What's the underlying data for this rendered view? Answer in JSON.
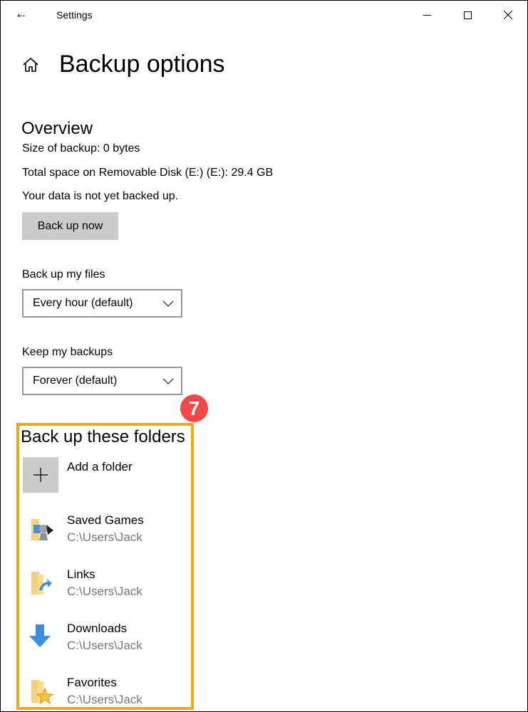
{
  "window": {
    "title": "Settings"
  },
  "page": {
    "title": "Backup options"
  },
  "overview": {
    "heading": "Overview",
    "size": "Size of backup: 0 bytes",
    "total": "Total space on Removable Disk (E:) (E:): 29.4 GB",
    "status": "Your data is not yet backed up.",
    "backup_now": "Back up now"
  },
  "frequency": {
    "label": "Back up my files",
    "value": "Every hour (default)"
  },
  "retention": {
    "label": "Keep my backups",
    "value": "Forever (default)"
  },
  "badge": "7",
  "folders": {
    "heading": "Back up these folders",
    "add": "Add a folder",
    "items": [
      {
        "name": "Saved Games",
        "path": "C:\\Users\\Jack",
        "icon": "saved-games-folder-icon"
      },
      {
        "name": "Links",
        "path": "C:\\Users\\Jack",
        "icon": "links-folder-icon"
      },
      {
        "name": "Downloads",
        "path": "C:\\Users\\Jack",
        "icon": "downloads-icon"
      },
      {
        "name": "Favorites",
        "path": "C:\\Users\\Jack",
        "icon": "favorites-folder-icon"
      }
    ]
  },
  "colors": {
    "highlight": "#f5a800",
    "badge": "#f04848"
  }
}
